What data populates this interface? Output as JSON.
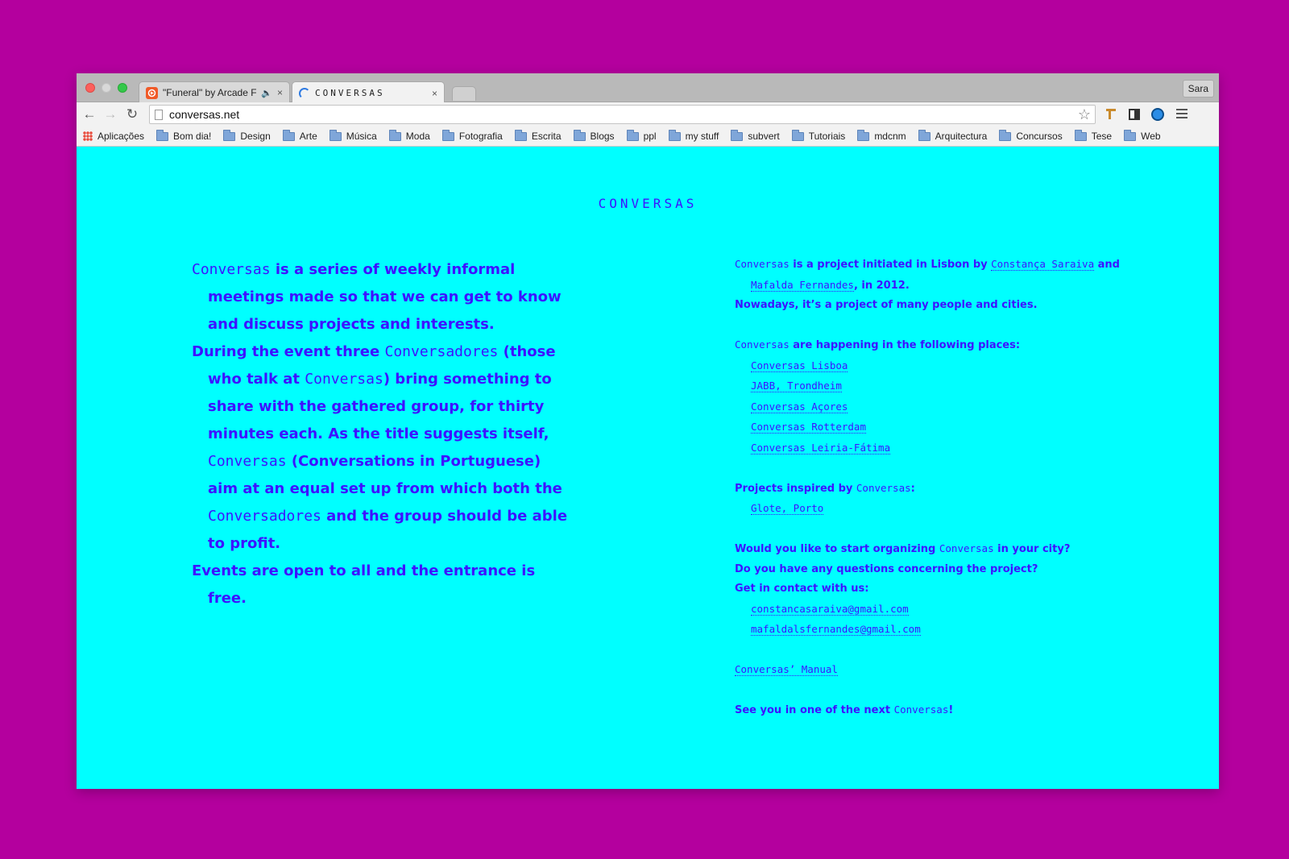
{
  "browser": {
    "tabs": [
      {
        "title": "\"Funeral\" by Arcade Fir",
        "sound_icon": "speaker-icon",
        "close": "×"
      },
      {
        "title": "CONVERSAS",
        "close": "×"
      }
    ],
    "profile": "Sara",
    "url": "conversas.net",
    "bookmarks": [
      "Aplicações",
      "Bom dia!",
      "Design",
      "Arte",
      "Música",
      "Moda",
      "Fotografia",
      "Escrita",
      "Blogs",
      "ppl",
      "my stuff",
      "subvert",
      "Tutoriais",
      "mdcnm",
      "Arquitectura",
      "Concursos",
      "Tese",
      "Web"
    ],
    "colors": {
      "page_bg": "#00ffff",
      "text": "#3d12ff",
      "desktop": "#b4009e"
    }
  },
  "page": {
    "title": "CONVERSAS",
    "intro": {
      "p1": {
        "a": "Conversas",
        "b": " is a series of weekly informal meetings made so that we can get to know and discuss projects and interests."
      },
      "p2": {
        "a": "During the event three ",
        "b": "Conversadores",
        "c": " (those who talk at ",
        "d": "Conversas",
        "e": ") bring something to share with the gathered group, for thirty minutes each. As the title suggests itself, ",
        "f": "Conversas",
        "g": " (Conversations in Portuguese) aim at an equal set up from which both the ",
        "h": "Conversadores",
        "i": " and the group should be able to profit."
      },
      "p3": "Events are open to all and the entrance is free."
    },
    "about": {
      "a": "Conversas",
      "b": " is a project initiated in Lisbon by ",
      "link1": "Constança Saraiva",
      "c": " and",
      "link2": "Mafalda Fernandes",
      "d": ", in 2012.",
      "e": "Nowadays, it’s a project of many people and cities."
    },
    "places": {
      "a": "Conversas",
      "b": " are happening in the following places:",
      "links": [
        "Conversas Lisboa",
        "JABB, Trondheim",
        "Conversas Açores",
        "Conversas Rotterdam",
        "Conversas Leiria-Fátima"
      ]
    },
    "inspired": {
      "a": "Projects inspired by ",
      "b": "Conversas",
      "c": ":",
      "link": "Glote, Porto"
    },
    "contact": {
      "a": "Would you like to start organizing ",
      "b": "Conversas",
      "c": " in your city?",
      "d": "Do you have any questions concerning the project?",
      "e": "Get in contact with us:",
      "emails": [
        "constancasaraiva@gmail.com",
        "mafaldalsfernandes@gmail.com"
      ]
    },
    "manual": "Conversas’ Manual",
    "outro": {
      "a": "See you in one of the next ",
      "b": "Conversas",
      "c": "!"
    }
  }
}
